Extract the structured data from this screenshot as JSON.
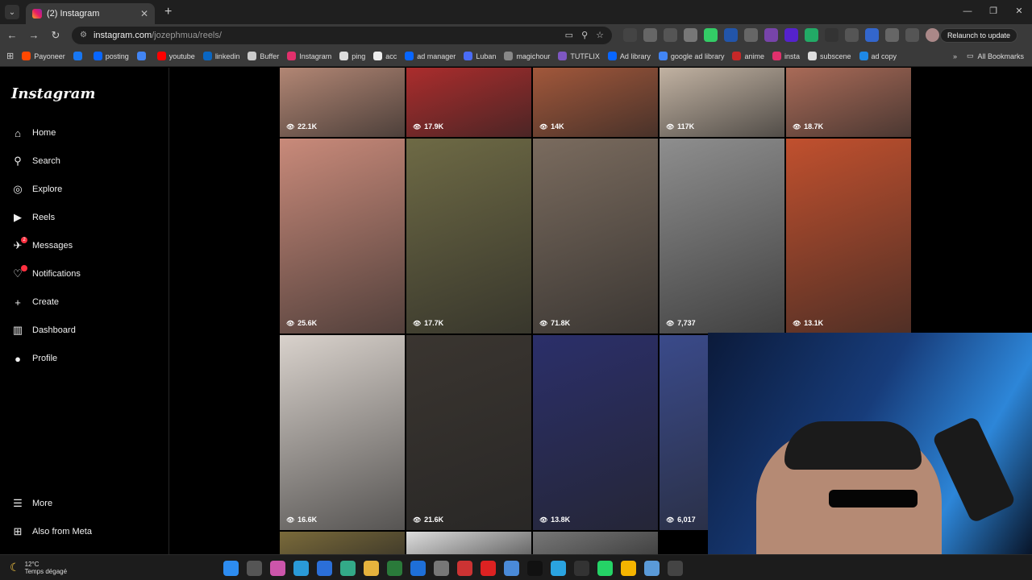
{
  "browser": {
    "tab_title": "(2) Instagram",
    "tab_close": "✕",
    "new_tab": "+",
    "url_host": "instagram.com",
    "url_path": "/jozephmua/reels/",
    "relaunch_label": "Relaunch to update",
    "all_bookmarks": "All Bookmarks",
    "bookmarks": [
      {
        "label": "Payoneer",
        "color": "#ff4800"
      },
      {
        "label": "",
        "color": "#1877f2"
      },
      {
        "label": "posting",
        "color": "#0866ff"
      },
      {
        "label": "",
        "color": "#4285f4"
      },
      {
        "label": "youtube",
        "color": "#ff0000"
      },
      {
        "label": "linkedin",
        "color": "#0a66c2"
      },
      {
        "label": "Buffer",
        "color": "#cccccc"
      },
      {
        "label": "Instagram",
        "color": "#e1306c"
      },
      {
        "label": "ping",
        "color": "#dddddd"
      },
      {
        "label": "acc",
        "color": "#eeeeee"
      },
      {
        "label": "ad manager",
        "color": "#0866ff"
      },
      {
        "label": "Luban",
        "color": "#4a6cf7"
      },
      {
        "label": "magichour",
        "color": "#888888"
      },
      {
        "label": "TUTFLIX",
        "color": "#7e57c2"
      },
      {
        "label": "Ad library",
        "color": "#0866ff"
      },
      {
        "label": "google ad library",
        "color": "#4285f4"
      },
      {
        "label": "anime",
        "color": "#c62828"
      },
      {
        "label": "insta",
        "color": "#e1306c"
      },
      {
        "label": "subscene",
        "color": "#dddddd"
      },
      {
        "label": "ad copy",
        "color": "#1e88e5"
      }
    ]
  },
  "sidebar": {
    "logo": "Instagram",
    "items": [
      {
        "label": "Home",
        "icon": "⌂"
      },
      {
        "label": "Search",
        "icon": "⚲"
      },
      {
        "label": "Explore",
        "icon": "◎"
      },
      {
        "label": "Reels",
        "icon": "▶"
      },
      {
        "label": "Messages",
        "icon": "✈",
        "badge": "2"
      },
      {
        "label": "Notifications",
        "icon": "♡",
        "badge": ""
      },
      {
        "label": "Create",
        "icon": "+"
      },
      {
        "label": "Dashboard",
        "icon": "▥"
      },
      {
        "label": "Profile",
        "icon": "●"
      }
    ],
    "bottom": [
      {
        "label": "More",
        "icon": "☰"
      },
      {
        "label": "Also from Meta",
        "icon": "⊞"
      }
    ]
  },
  "reels": [
    {
      "views": "22.1K",
      "color": "#b98b78"
    },
    {
      "views": "17.9K",
      "color": "#b22d2d"
    },
    {
      "views": "14K",
      "color": "#a85a3c"
    },
    {
      "views": "117K",
      "color": "#c9b9a8"
    },
    {
      "views": "18.7K",
      "color": "#b06e5a"
    },
    {
      "views": "25.6K",
      "color": "#c98a7a"
    },
    {
      "views": "17.7K",
      "color": "#6e6a45"
    },
    {
      "views": "71.8K",
      "color": "#7a6b5e"
    },
    {
      "views": "7,737",
      "color": "#8e8e8e"
    },
    {
      "views": "13.1K",
      "color": "#c1502e"
    },
    {
      "views": "16.6K",
      "color": "#d9d2cc"
    },
    {
      "views": "21.6K",
      "color": "#3a3530"
    },
    {
      "views": "13.8K",
      "color": "#2b2f6a"
    },
    {
      "views": "6,017",
      "color": "#3a4a8a"
    },
    {
      "views": "",
      "color": "#555555"
    },
    {
      "views": "",
      "color": "#7a6a3a"
    },
    {
      "views": "",
      "color": "#dddddd"
    },
    {
      "views": "",
      "color": "#777777"
    }
  ],
  "taskbar": {
    "temp": "12°C",
    "weather": "Temps dégagé"
  }
}
